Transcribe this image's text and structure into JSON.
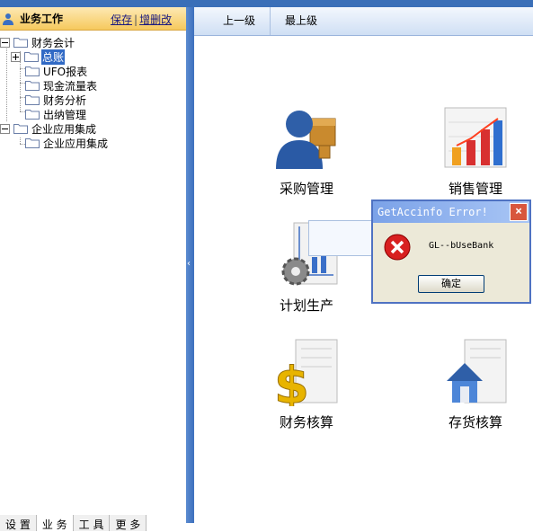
{
  "left_panel": {
    "title": "业务工作",
    "save_link": "保存",
    "separator": "|",
    "add_delete_link": "增删改",
    "tree": {
      "root1": "财务会计",
      "items1": [
        "总账",
        "UFO报表",
        "现金流量表",
        "财务分析",
        "出纳管理"
      ],
      "root2": "企业应用集成",
      "items2": [
        "企业应用集成"
      ]
    },
    "bottom_tabs": [
      "设 置",
      "业 务",
      "工 具",
      "更 多"
    ]
  },
  "toolbar": {
    "up_level": "上一级",
    "top_level": "最上级"
  },
  "modules": {
    "purchase": "采购管理",
    "sales": "销售管理",
    "planning": "计划生产",
    "finance": "财务核算",
    "inventory": "存货核算"
  },
  "dialog": {
    "title": "GetAccinfo Error!",
    "message": "GL--bUseBank",
    "ok_label": "确定",
    "close_symbol": "×"
  },
  "colors": {
    "accent_blue": "#3d70bd",
    "header_gold": "#f6c95d",
    "dialog_bg": "#ece9d8",
    "error_red": "#d82020"
  }
}
